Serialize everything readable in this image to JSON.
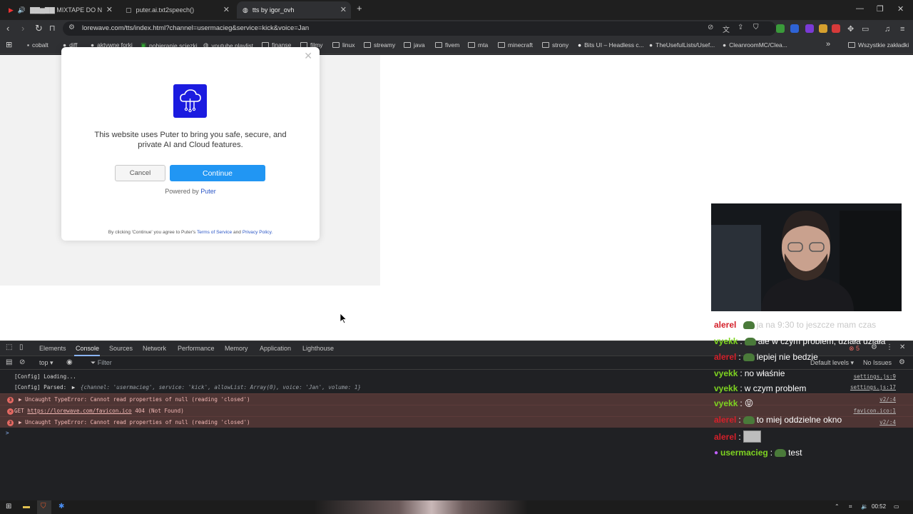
{
  "browser": {
    "tabs": [
      {
        "label": "▇▇▆▇▇ MIXTAPE DO N"
      },
      {
        "label": "puter.ai.txt2speech()"
      },
      {
        "label": "tts by igor_ovh"
      }
    ],
    "url": "lorewave.com/tts/index.html?channel=usermacieg&service=kick&voice=Jan",
    "bookmarks": [
      "cobalt",
      "diff",
      "aktywne forki",
      "pobieranie sciezki",
      "youtube playlist",
      "finanse",
      "filmy",
      "linux",
      "streamy",
      "java",
      "fivem",
      "mta",
      "minecraft",
      "strony",
      "Bits UI – Headless c...",
      "TheUsefulLists/Usef...",
      "CleanroomMC/Clea..."
    ],
    "bookmarks_all": "Wszystkie zakładki"
  },
  "dialog": {
    "message": "This website uses Puter to bring you safe, secure, and private AI and Cloud features.",
    "cancel_label": "Cancel",
    "continue_label": "Continue",
    "powered_prefix": "Powered by",
    "powered_brand": "Puter",
    "terms_prefix": "By clicking 'Continue' you agree to Puter's",
    "terms_link": "Terms of Service",
    "terms_and": "and",
    "privacy_link": "Privacy Policy."
  },
  "devtools": {
    "tabs": [
      "Elements",
      "Console",
      "Sources",
      "Network",
      "Performance",
      "Memory",
      "Application",
      "Lighthouse"
    ],
    "context": "top",
    "filter_placeholder": "Filter",
    "levels": "Default levels",
    "issues": "No Issues",
    "error_count": "5",
    "console": [
      {
        "text": "[Config] Loading...",
        "src": "settings.js:9"
      },
      {
        "prefix": "[Config] Parsed:",
        "obj": "{channel: 'usermacieg', service: 'kick', allowList: Array(0), voice: 'Jan', volume: 1}",
        "src": "settings.js:17"
      },
      {
        "count": "3",
        "text": "Uncaught TypeError: Cannot read properties of null (reading 'closed')",
        "src": "v2/:4"
      },
      {
        "get": "GET",
        "link": "https://lorewave.com/favicon.ico",
        "status": "404 (Not Found)",
        "src": "favicon.ico:1"
      },
      {
        "count": "3",
        "text": "Uncaught TypeError: Cannot read properties of null (reading 'closed')",
        "src": "v2/:4"
      }
    ],
    "prompt": ">"
  },
  "chat": [
    {
      "user": "alerel",
      "color": "#d4202a",
      "msg": "ja na 9:30 to jeszcze mam czas",
      "emote": true
    },
    {
      "user": "vyekk",
      "color": "#7ed321",
      "msg": "ale w czym problem, działa działa",
      "emote": true
    },
    {
      "user": "alerel",
      "color": "#d4202a",
      "msg": "lepiej nie bedzie",
      "emote": true
    },
    {
      "user": "vyekk",
      "color": "#7ed321",
      "msg": "no właśnie",
      "emote": false
    },
    {
      "user": "vyekk",
      "color": "#7ed321",
      "msg": "w czym problem",
      "emote": false
    },
    {
      "user": "vyekk",
      "color": "#7ed321",
      "msg": "😝",
      "emote": false
    },
    {
      "user": "alerel",
      "color": "#d4202a",
      "msg": "to miej oddzielne okno",
      "emote": true
    },
    {
      "user": "alerel",
      "color": "#d4202a",
      "msg": "",
      "emote": false
    },
    {
      "user": "usermacieg",
      "color": "#7ed321",
      "msg": "test",
      "emote": true
    }
  ],
  "taskbar": {
    "time": "00:52"
  }
}
